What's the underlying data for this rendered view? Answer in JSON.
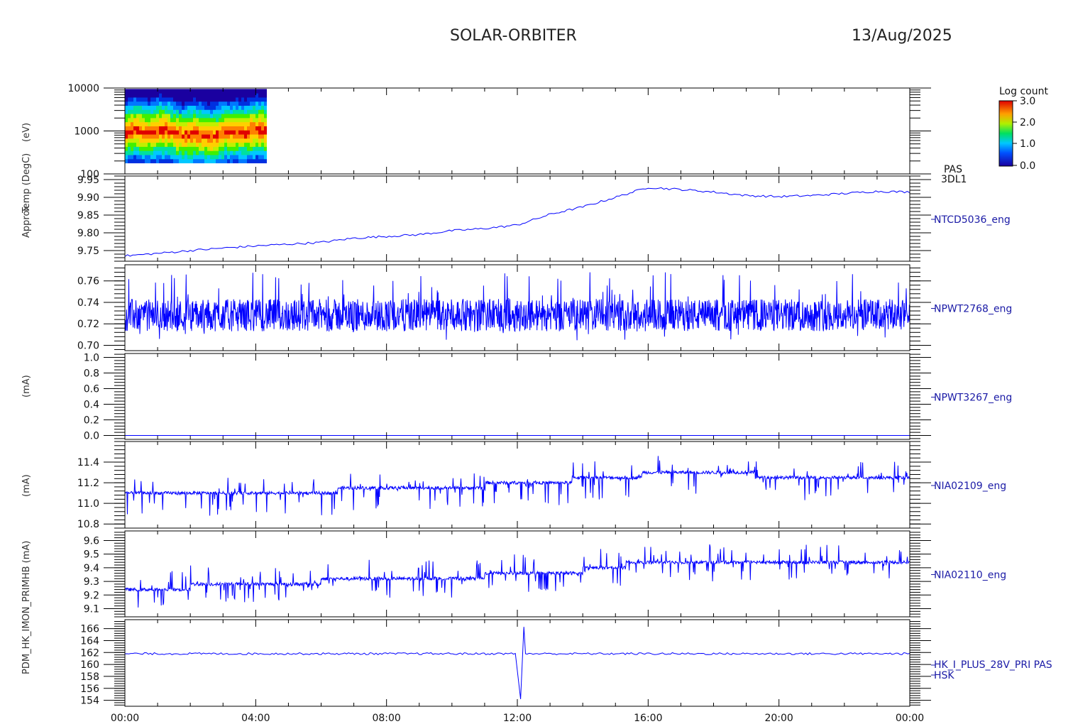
{
  "header": {
    "mission": "SOLAR-ORBITER",
    "date": "13/Aug/2025"
  },
  "ylabels": {
    "overlap_a": "(eV)",
    "overlap_b": "Temp (DegC)",
    "overlap_c": "Approx",
    "overlap_d": "(mA)",
    "overlap_e": "(mA)",
    "overlap_f": "PDM_HK_IMON_PRIMHB (mA)"
  },
  "colorbar": {
    "title": "Log count",
    "ticks": [
      "3.0",
      "2.0",
      "1.0",
      "0.0"
    ]
  },
  "colors": {
    "trace": "#0000ff",
    "label": "#1a1aa6",
    "axis": "#000000"
  },
  "chart_data": [
    {
      "type": "heatmap",
      "panel_label": [
        "PAS",
        "3DL1"
      ],
      "ylog": true,
      "ylim": [
        100,
        10000
      ],
      "yticks": [
        100,
        1000,
        10000
      ],
      "yticklabels": [
        "100",
        "1000",
        "10000"
      ],
      "data_x_range": [
        0,
        4.3
      ],
      "band_peak_ev": 900,
      "colorscale": "log count 0.0-3.0"
    },
    {
      "type": "line",
      "name": "NTCD5036_eng",
      "ylim": [
        9.72,
        9.96
      ],
      "yticks": [
        9.75,
        9.8,
        9.85,
        9.9,
        9.95
      ],
      "yticklabels": [
        "9.75",
        "9.80",
        "9.85",
        "9.90",
        "9.95"
      ],
      "x": [
        0,
        1,
        2,
        3,
        4,
        5,
        6,
        7,
        8,
        9,
        10,
        11,
        12,
        13,
        14,
        15,
        16,
        17,
        18,
        19,
        20,
        21,
        22,
        23,
        24
      ],
      "values": [
        9.735,
        9.742,
        9.75,
        9.757,
        9.763,
        9.768,
        9.773,
        9.785,
        9.79,
        9.795,
        9.806,
        9.812,
        9.822,
        9.852,
        9.873,
        9.9,
        9.928,
        9.922,
        9.915,
        9.905,
        9.902,
        9.905,
        9.911,
        9.917,
        9.915
      ]
    },
    {
      "type": "line",
      "name": "NPWT2768_eng",
      "ylim": [
        0.695,
        0.775
      ],
      "yticks": [
        0.7,
        0.72,
        0.74,
        0.76
      ],
      "yticklabels": [
        "0.70",
        "0.72",
        "0.74",
        "0.76"
      ],
      "x": [
        0,
        24
      ],
      "values": [
        0.728,
        0.728
      ],
      "noise": {
        "band": [
          0.714,
          0.744
        ],
        "spike_high": 0.768,
        "spike_low": 0.704
      }
    },
    {
      "type": "line",
      "name": "NPWT3267_eng",
      "ylim": [
        -0.05,
        1.05
      ],
      "yticks": [
        0,
        0.2,
        0.4,
        0.6,
        0.8,
        1.0
      ],
      "yticklabels": [
        "0.0",
        "0.2",
        "0.4",
        "0.6",
        "0.8",
        "1.0"
      ],
      "x": [
        0,
        24
      ],
      "values": [
        0.0,
        0.0
      ]
    },
    {
      "type": "line",
      "name": "NIA02109_eng",
      "ylim": [
        10.76,
        11.6
      ],
      "yticks": [
        10.8,
        11.0,
        11.2,
        11.4
      ],
      "yticklabels": [
        "10.8",
        "11.0",
        "11.2",
        "11.4"
      ],
      "x": [
        0,
        2,
        4,
        6,
        8,
        10,
        12,
        14,
        16,
        18,
        20,
        22,
        24
      ],
      "values": [
        11.1,
        11.1,
        11.11,
        11.12,
        11.14,
        11.15,
        11.2,
        11.23,
        11.28,
        11.3,
        11.26,
        11.27,
        11.27
      ],
      "noise": {
        "spread_low": 0.22,
        "spread_high": 0.16
      }
    },
    {
      "type": "line",
      "name": "NIA02110_eng",
      "ylim": [
        9.04,
        9.67
      ],
      "yticks": [
        9.1,
        9.2,
        9.3,
        9.4,
        9.5,
        9.6
      ],
      "yticklabels": [
        "9.1",
        "9.2",
        "9.3",
        "9.4",
        "9.5",
        "9.6"
      ],
      "x": [
        0,
        2,
        4,
        6,
        8,
        10,
        12,
        14,
        16,
        18,
        20,
        22,
        24
      ],
      "values": [
        9.25,
        9.26,
        9.28,
        9.3,
        9.31,
        9.33,
        9.35,
        9.38,
        9.44,
        9.45,
        9.42,
        9.42,
        9.43
      ],
      "noise": {
        "spread_low": 0.14,
        "spread_high": 0.14
      }
    },
    {
      "type": "line",
      "name": "HK_I_PLUS_28V_PRI PAS",
      "name_line2": "HSK",
      "ylim": [
        153,
        167.5
      ],
      "yticks": [
        154,
        156,
        158,
        160,
        162,
        164,
        166
      ],
      "yticklabels": [
        "154",
        "156",
        "158",
        "160",
        "162",
        "164",
        "166"
      ],
      "x": [
        0,
        12.05,
        12.1,
        12.2,
        24
      ],
      "values": [
        161.8,
        161.8,
        154.2,
        166.3,
        161.8
      ]
    }
  ],
  "xaxis": {
    "xlim": [
      0,
      24
    ],
    "ticks": [
      0,
      4,
      8,
      12,
      16,
      20,
      24
    ],
    "ticklabels": [
      "00:00",
      "04:00",
      "08:00",
      "12:00",
      "16:00",
      "20:00",
      "00:00"
    ]
  }
}
